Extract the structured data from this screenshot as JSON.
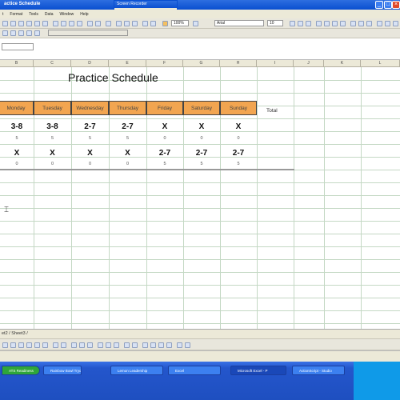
{
  "window": {
    "title": "actice Schedule"
  },
  "recorder": {
    "title": "Screen Recorder"
  },
  "menubar": {
    "items": [
      "t",
      "Format",
      "Tools",
      "Data",
      "Window",
      "Help"
    ]
  },
  "toolbar": {
    "zoom": "100%",
    "font": "Arial",
    "font_size": "10"
  },
  "columns": [
    "B",
    "C",
    "D",
    "E",
    "F",
    "G",
    "H",
    "I",
    "J",
    "K",
    "L"
  ],
  "sheet": {
    "title": "Practice Schedule",
    "days": [
      "Monday",
      "Tuesday",
      "Wednesday",
      "Thursday",
      "Friday",
      "Saturday",
      "Sunday"
    ],
    "total_label": "Total",
    "row1": [
      "3-8",
      "3-8",
      "2-7",
      "2-7",
      "X",
      "X",
      "X"
    ],
    "row1_sub": [
      "5",
      "5",
      "5",
      "5",
      "0",
      "0",
      "0"
    ],
    "row2": [
      "X",
      "X",
      "X",
      "X",
      "2-7",
      "2-7",
      "2-7"
    ],
    "row2_sub": [
      "0",
      "0",
      "0",
      "0",
      "5",
      "5",
      "5"
    ]
  },
  "sheet_tabs": {
    "label": "et2 / Sheet3 /"
  },
  "taskbar": {
    "items": [
      "ATS Readiness",
      "Rainbow Bowl Tryo",
      "Lemon Leadership",
      "Excel",
      "Microsoft Excel - P",
      "ActionScript - Studio"
    ]
  }
}
